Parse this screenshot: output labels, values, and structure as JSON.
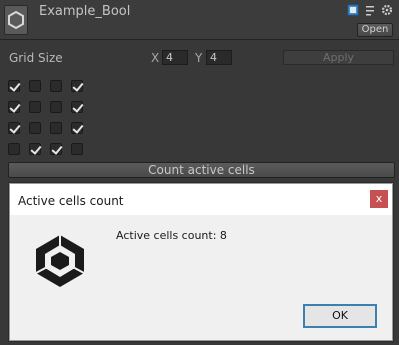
{
  "header": {
    "title": "Example_Bool",
    "open_label": "Open",
    "icons": [
      "book-icon",
      "preset-sliders-icon",
      "gear-icon"
    ]
  },
  "grid": {
    "label": "Grid Size",
    "x_label": "X",
    "x_value": "4",
    "y_label": "Y",
    "y_value": "4",
    "apply_label": "Apply",
    "cells": [
      [
        true,
        false,
        false,
        true
      ],
      [
        true,
        false,
        false,
        true
      ],
      [
        true,
        false,
        false,
        true
      ],
      [
        false,
        true,
        true,
        false
      ]
    ]
  },
  "count_button_label": "Count active cells",
  "dialog": {
    "title": "Active cells count",
    "close_label": "x",
    "message": "Active cells count: 8",
    "ok_label": "OK",
    "icon": "unity-logo-icon"
  },
  "colors": {
    "background": "#383838",
    "dialog_close": "#c75050",
    "ok_border": "#3c7fb1"
  }
}
